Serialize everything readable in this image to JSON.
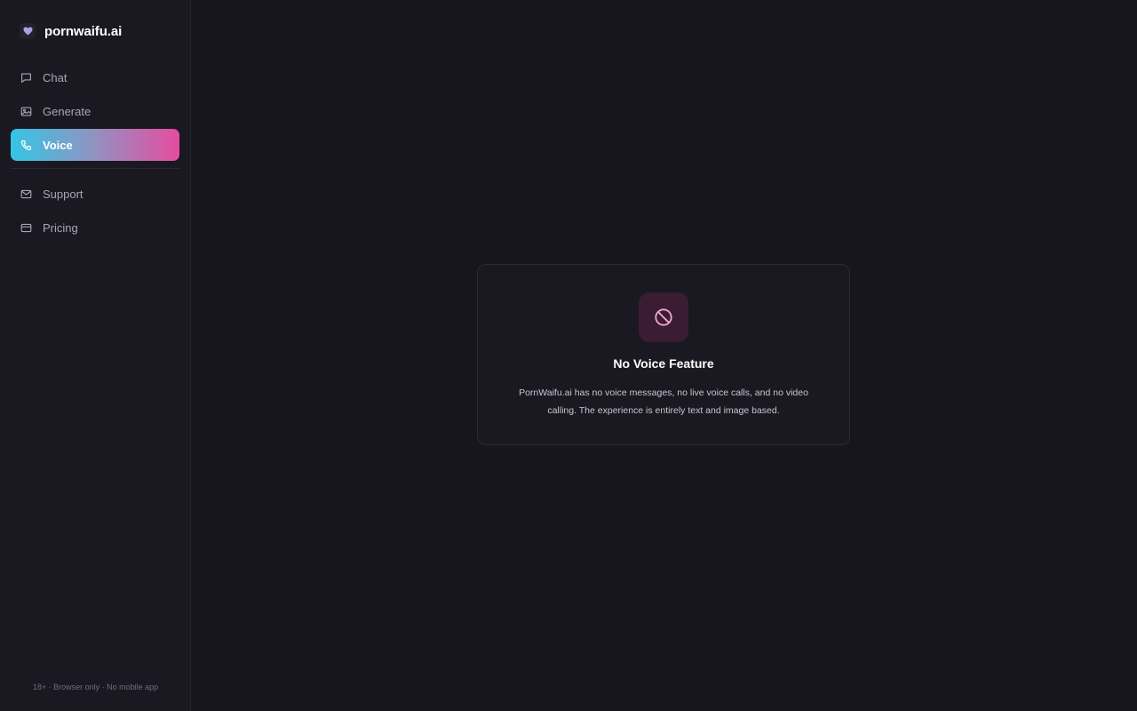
{
  "brand": {
    "name": "pornwaifu.ai",
    "logo_icon": "heart-icon"
  },
  "nav": {
    "primary": [
      {
        "label": "Chat",
        "icon": "chat-bubble-icon"
      },
      {
        "label": "Generate",
        "icon": "image-icon"
      },
      {
        "label": "Voice",
        "icon": "phone-icon",
        "active": true
      }
    ],
    "secondary": [
      {
        "label": "Support",
        "icon": "mail-icon"
      },
      {
        "label": "Pricing",
        "icon": "credit-card-icon"
      }
    ]
  },
  "sidebar_footer": "18+ · Browser only · No mobile app",
  "notice": {
    "icon": "no-entry-icon",
    "title": "No Voice Feature",
    "message": "PornWaifu.ai has no voice messages, no live voice calls, and no video calling. The experience is entirely text and image based."
  },
  "colors": {
    "background": "#17161d",
    "sidebar": "#1a1921",
    "active_gradient_start": "#35c5e6",
    "active_gradient_end": "#e54c9f",
    "icon_tile": "#3a1d33",
    "icon_accent": "#f0a6cf"
  }
}
